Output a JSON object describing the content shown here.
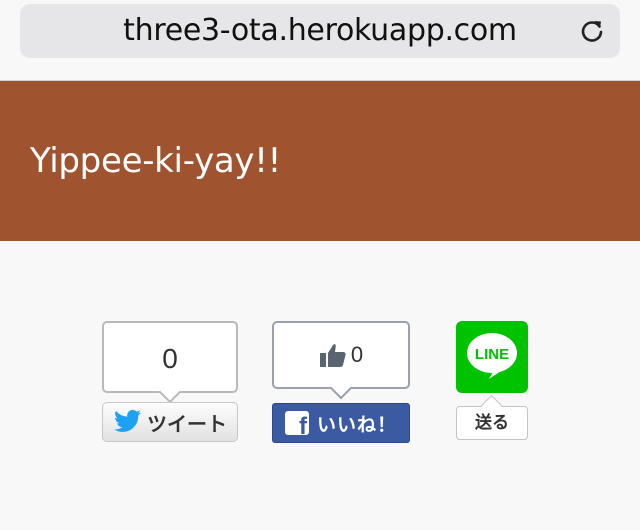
{
  "browser": {
    "url": "three3-ota.herokuapp.com",
    "reload_icon": "reload-icon"
  },
  "hero": {
    "title": "Yippee-ki-yay!!",
    "background": "#a0532f"
  },
  "share": {
    "twitter": {
      "count": "0",
      "label": "ツイート",
      "icon": "twitter-bird-icon",
      "color": "#1da1f2"
    },
    "facebook": {
      "count": "0",
      "label": "いいね！",
      "icon": "facebook-f-icon",
      "count_icon": "thumbs-up-icon",
      "color": "#3b5aa2"
    },
    "line": {
      "icon_text": "LINE",
      "label": "送る",
      "icon": "line-logo-icon",
      "color": "#00c300"
    }
  }
}
